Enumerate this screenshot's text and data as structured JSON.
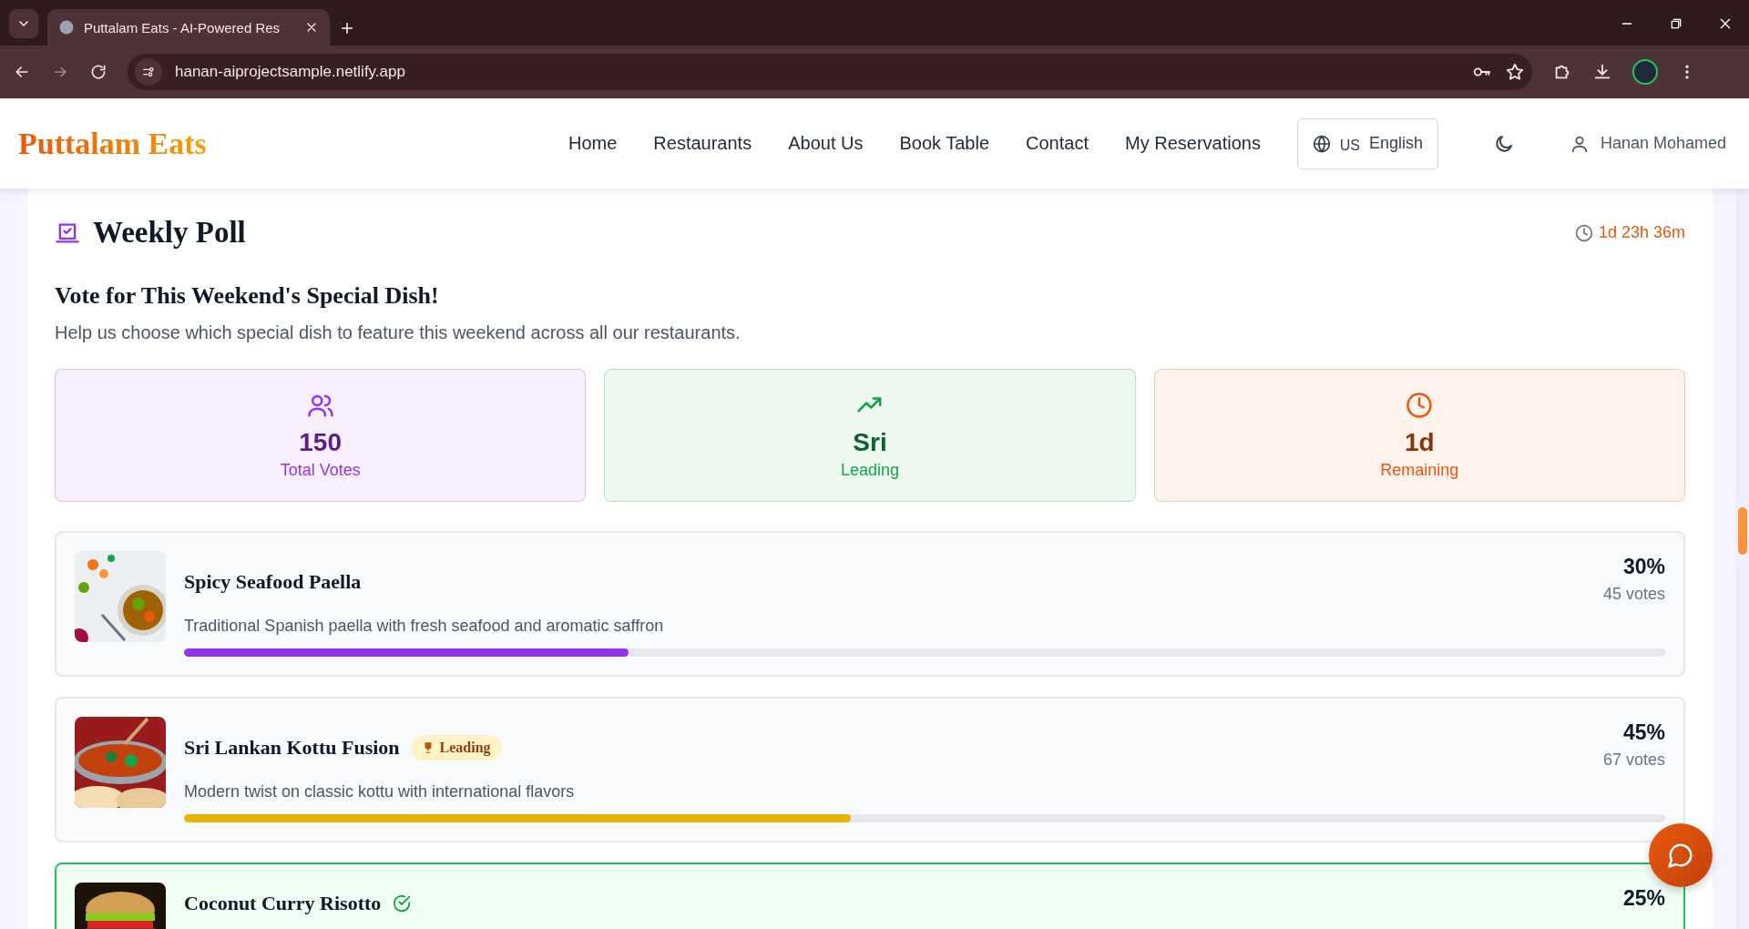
{
  "browser": {
    "tab_title": "Puttalam Eats - AI-Powered Res",
    "url": "hanan-aiprojectsample.netlify.app"
  },
  "nav": {
    "logo": "Puttalam Eats",
    "links": [
      "Home",
      "Restaurants",
      "About Us",
      "Book Table",
      "Contact",
      "My Reservations"
    ],
    "language": {
      "code": "US",
      "label": "English"
    },
    "user": "Hanan Mohamed"
  },
  "poll": {
    "title": "Weekly Poll",
    "countdown": "1d 23h 36m",
    "heading": "Vote for This Weekend's Special Dish!",
    "description": "Help us choose which special dish to feature this weekend across all our restaurants.",
    "stats": [
      {
        "kind": "votes",
        "value": "150",
        "label": "Total Votes",
        "color": "#9333ea"
      },
      {
        "kind": "leading",
        "value": "Sri",
        "label": "Leading",
        "color": "#16a34a"
      },
      {
        "kind": "time",
        "value": "1d",
        "label": "Remaining",
        "color": "#ea580c"
      }
    ],
    "options": [
      {
        "name": "Spicy Seafood Paella",
        "description": "Traditional Spanish paella with fresh seafood and aromatic saffron",
        "percent": "30%",
        "votes": "45 votes",
        "level": 0.3,
        "color": "#9333ea",
        "voted": false
      },
      {
        "name": "Sri Lankan Kottu Fusion",
        "badge": "Leading",
        "description": "Modern twist on classic kottu with international flavors",
        "percent": "45%",
        "votes": "67 votes",
        "level": 0.45,
        "color": "#eab308",
        "voted": false
      },
      {
        "name": "Coconut Curry Risotto",
        "percent": "25%",
        "voted": true
      }
    ]
  }
}
